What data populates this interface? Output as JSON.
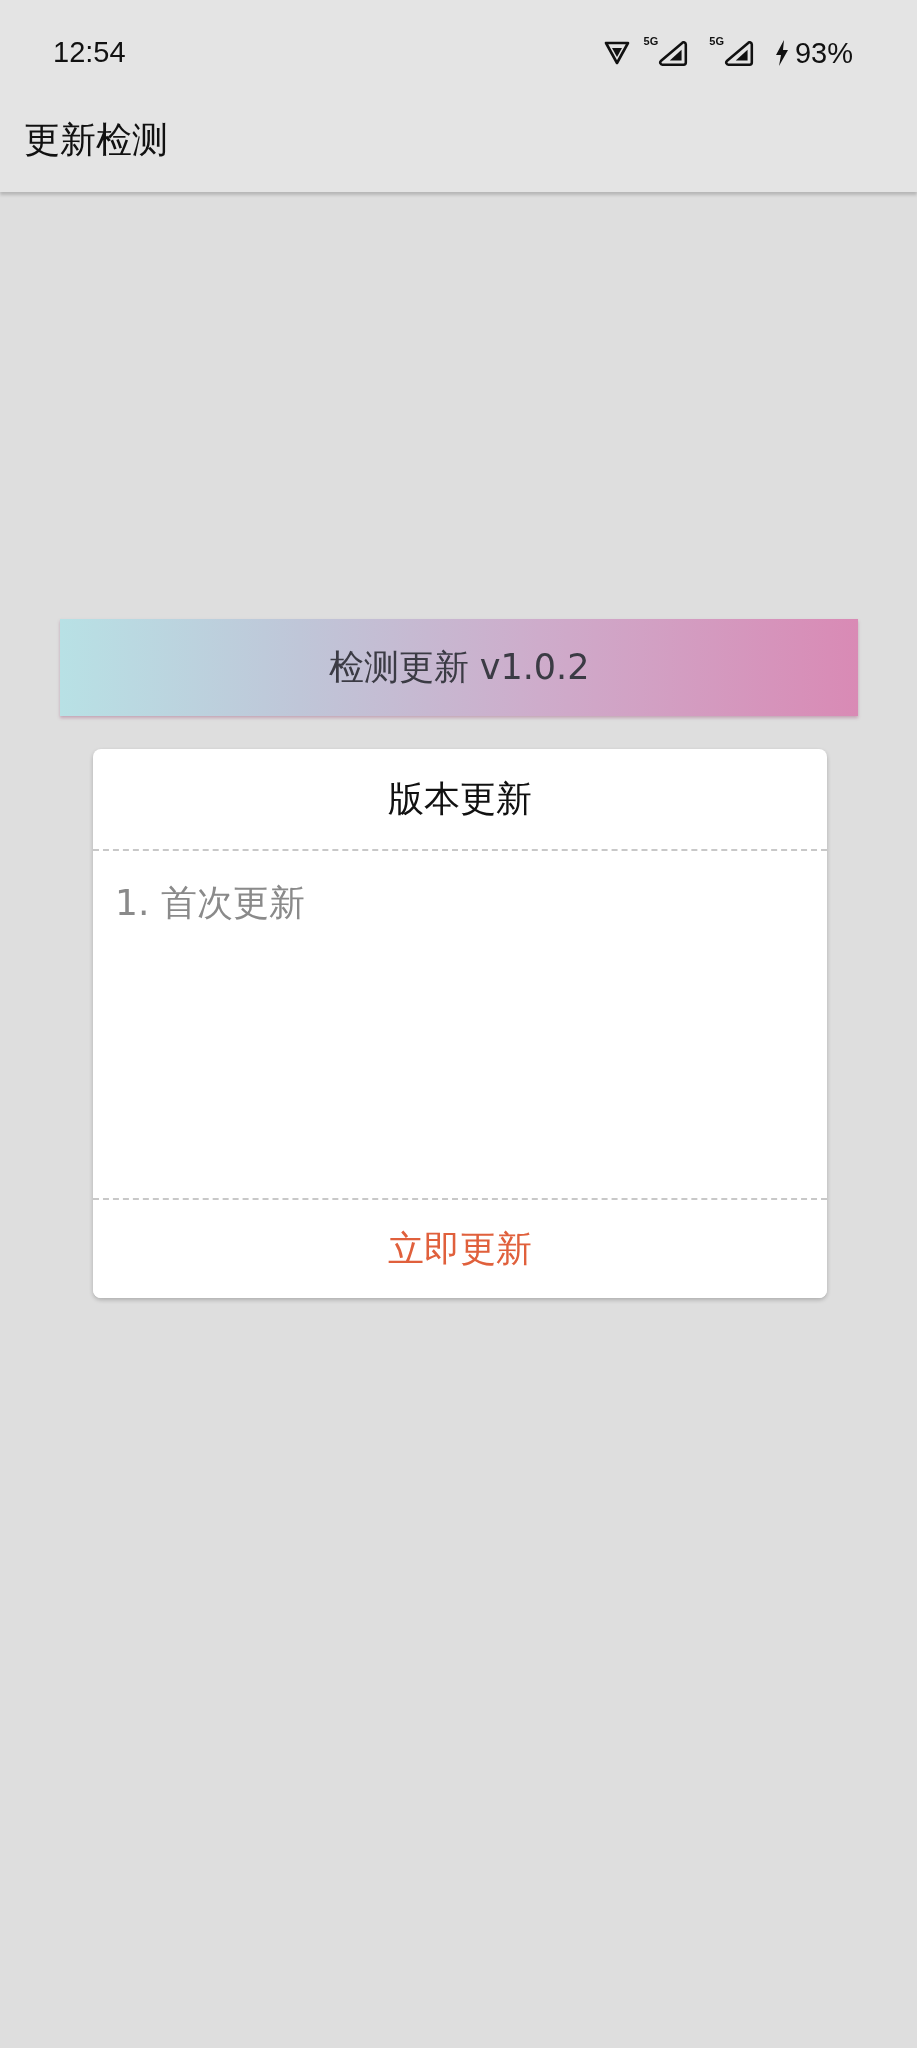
{
  "status_bar": {
    "time": "12:54",
    "wifi": true,
    "networks": [
      {
        "label": "5G"
      },
      {
        "label": "5G"
      }
    ],
    "charging": true,
    "battery": "93%"
  },
  "app_bar": {
    "title": "更新检测"
  },
  "banner": {
    "title": "检测更新 v1.0.2"
  },
  "dialog": {
    "title": "版本更新",
    "notes": [
      "1. 首次更新"
    ],
    "button": "立即更新"
  }
}
